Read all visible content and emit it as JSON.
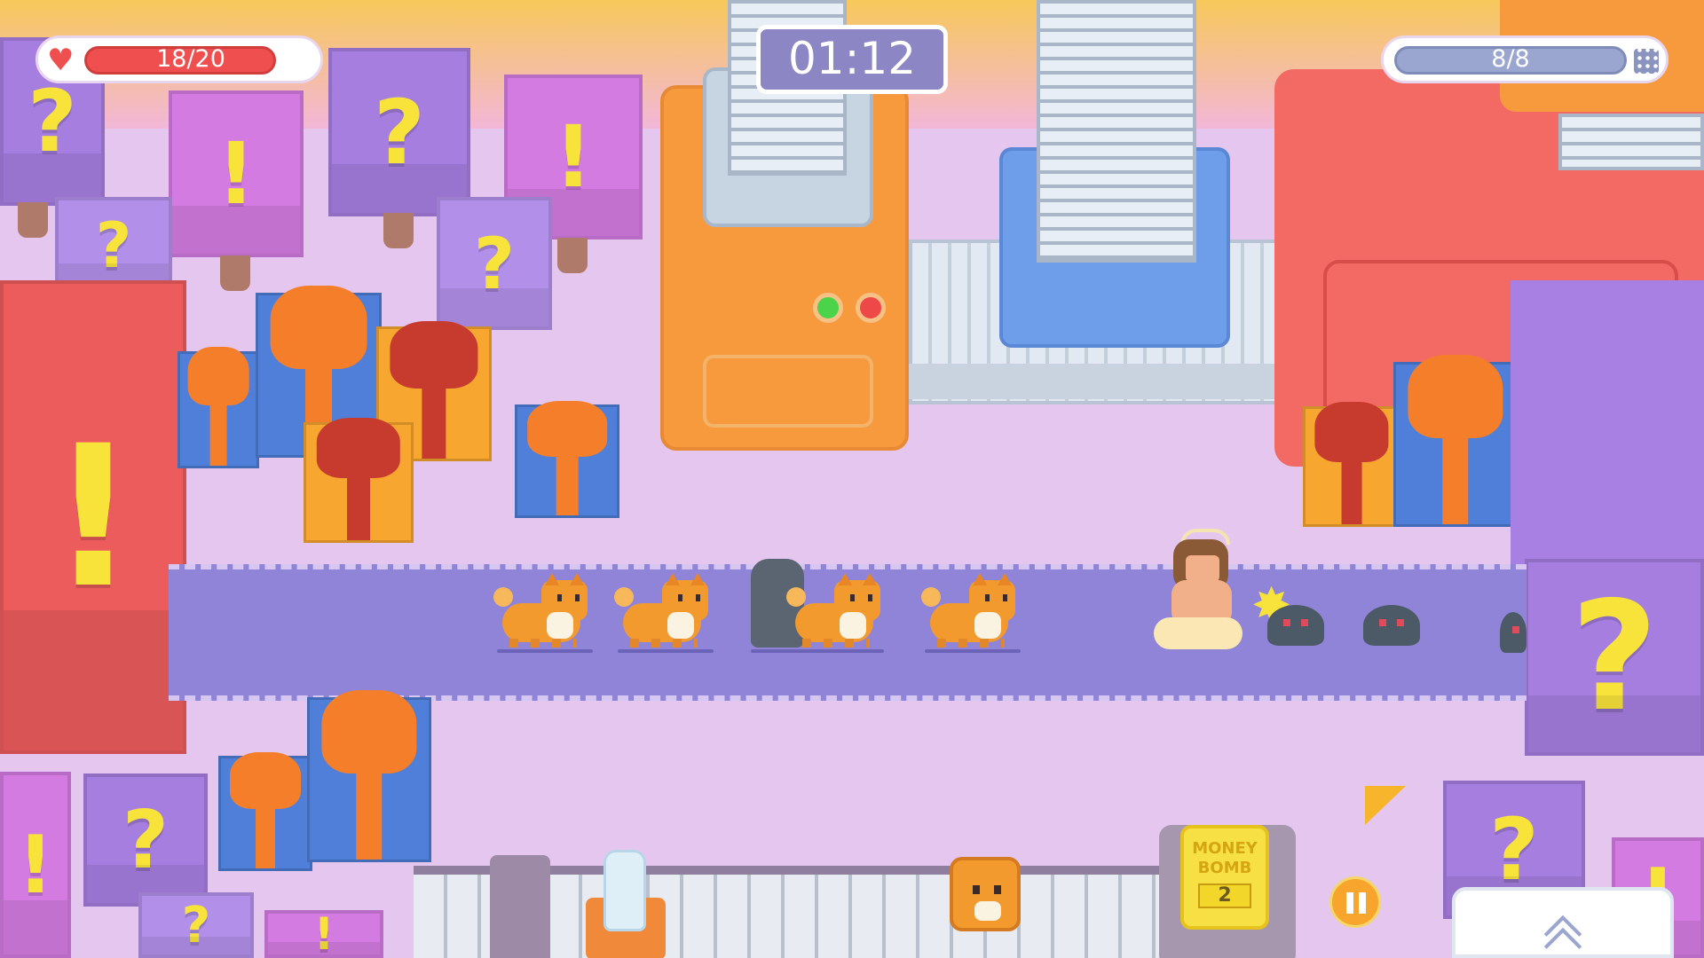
{
  "hud": {
    "health_text": "18/20",
    "health_fraction": 0.9,
    "timer": "01:12",
    "wave_text": "8/8",
    "wave_fraction": 1.0
  },
  "bottom": {
    "money_bomb_label_1": "MONEY",
    "money_bomb_label_2": "BOMB",
    "money_bomb_count": "2"
  },
  "box_glyphs": {
    "question": "?",
    "exclaim": "!"
  },
  "icons": [
    "heart-icon",
    "calendar-icon",
    "pause-icon",
    "chevron-up-icon",
    "cursor-arrow-icon"
  ],
  "colors": {
    "health": "#ef4f4f",
    "road": "#8f84d8",
    "accent": "#f7a52c"
  }
}
